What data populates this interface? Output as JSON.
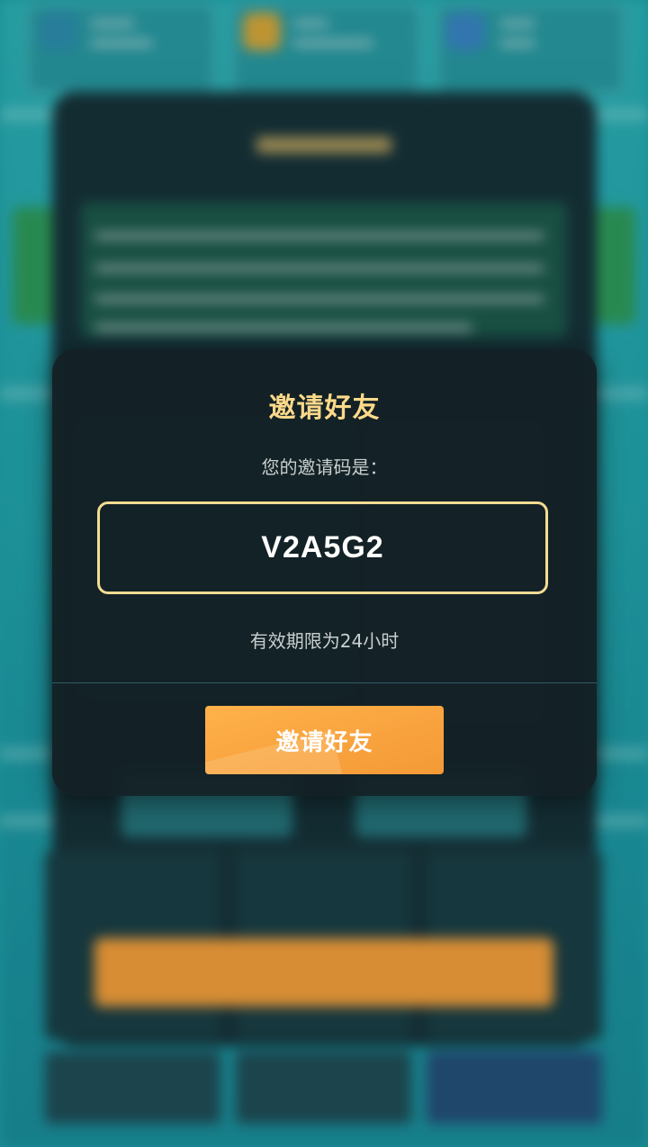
{
  "background": {
    "description_hidden": true,
    "top_resources": [
      {
        "icon": "gem-resource-icon",
        "color": "#2d8fb0"
      },
      {
        "icon": "coin-resource-icon",
        "color": "#d8a93a"
      },
      {
        "icon": "water-resource-icon",
        "color": "#3a86c8"
      }
    ],
    "accent_colors": {
      "panel": "#16333a",
      "green": "#2e9d5c",
      "orange": "#f5a13c"
    }
  },
  "invite_modal": {
    "title": "邀请好友",
    "code_caption": "您的邀请码是：",
    "invite_code": "V2A5G2",
    "validity_text": "有效期限为24小时",
    "invite_button_label": "邀请好友",
    "colors": {
      "title": "#fcd98a",
      "code_border": "#f3dc93",
      "button": "#f8a23e"
    }
  }
}
